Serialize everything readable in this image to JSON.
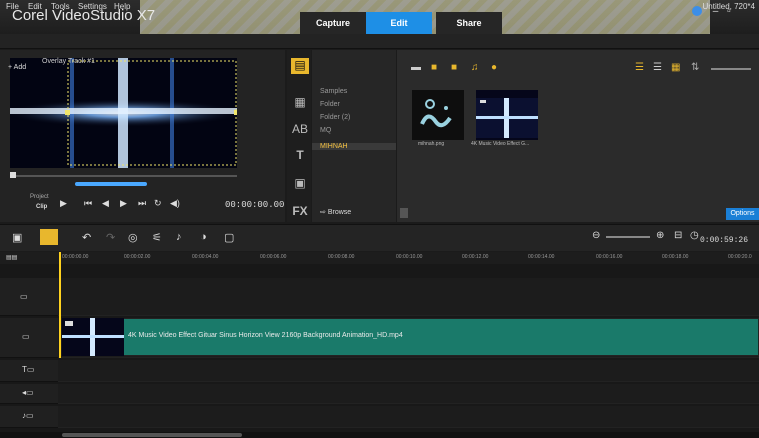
{
  "app": {
    "title": "Corel VideoStudio X7",
    "steps": [
      "Capture",
      "Edit",
      "Share"
    ],
    "active_step": "Edit"
  },
  "menu": {
    "items": [
      "File",
      "Edit",
      "Tools",
      "Settings",
      "Help"
    ],
    "project_info": "Untitled, 720*4"
  },
  "preview": {
    "overlay_label": "Overlay Track #1",
    "project_label": "Project",
    "clip_label": "Clip",
    "timecode": "00:00:00.00"
  },
  "library": {
    "add_label": "Add",
    "browse_label": "Browse",
    "folders": [
      "Samples",
      "Folder",
      "Folder (2)",
      "MQ",
      "MIHNAH"
    ],
    "active_folder": "MIHNAH",
    "thumbs": [
      {
        "label": "mihnah.png"
      },
      {
        "label": "4K Music Video Effect G..."
      }
    ],
    "options_label": "Options"
  },
  "timeline": {
    "duration": "0:00:59:26",
    "ruler": [
      "00:00:00.00",
      "00:00:02.00",
      "00:00:04.00",
      "00:00:06.00",
      "00:00:08.00",
      "00:00:10.00",
      "00:00:12.00",
      "00:00:14.00",
      "00:00:16.00",
      "00:00:18.00",
      "00:00:20.0"
    ],
    "clip_title": "4K Music Video Effect Gituar Sinus Horizon View 2160p Background Animation_HD.mp4"
  },
  "colors": {
    "accent": "#1e8fe6",
    "clip": "#1a7a6a",
    "playhead": "#ffd21f",
    "active_folder": "#f5c242"
  }
}
